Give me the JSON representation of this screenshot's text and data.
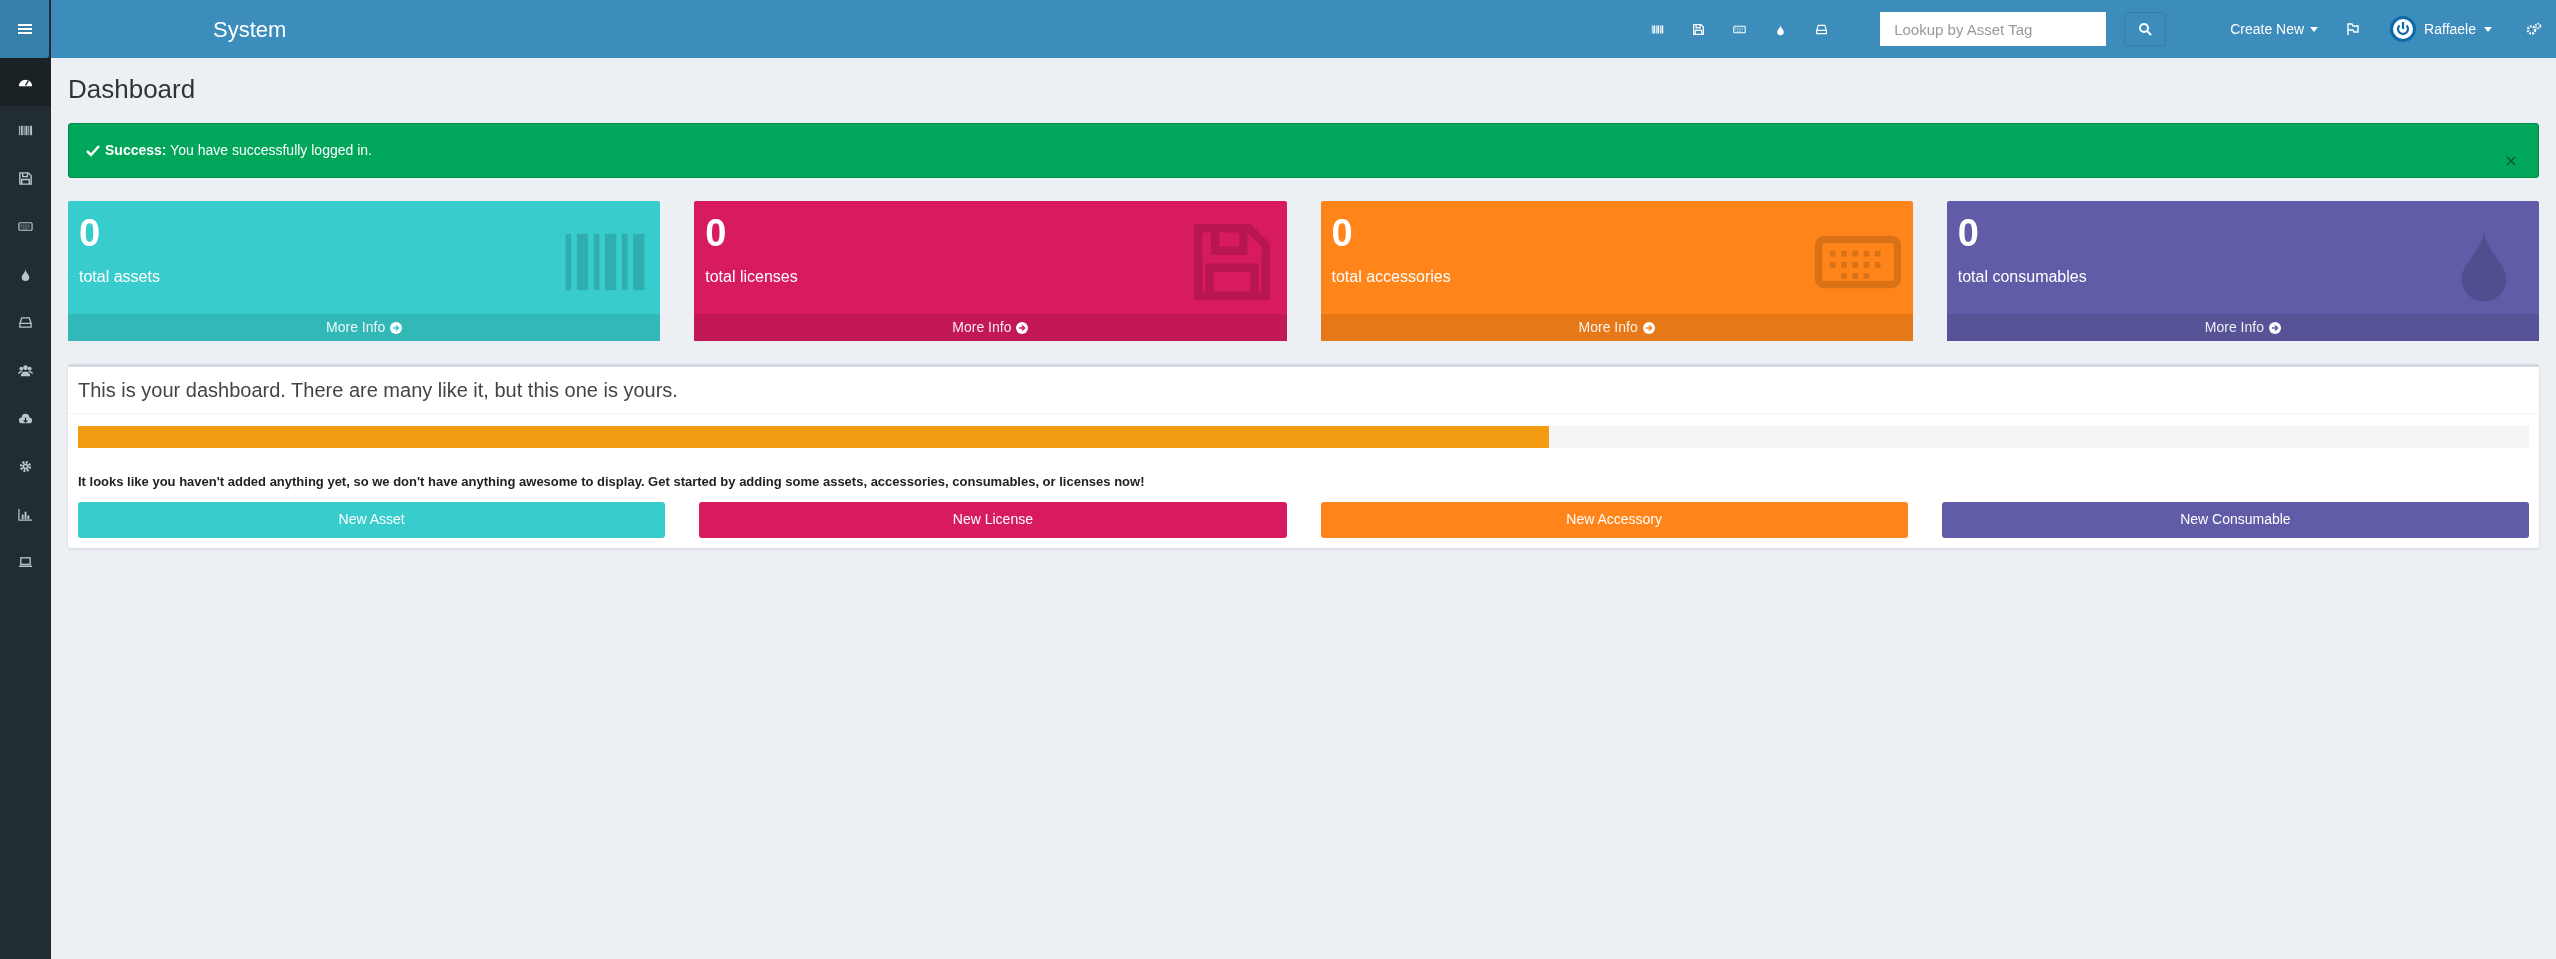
{
  "header": {
    "title": "System",
    "nav_icons": [
      {
        "kind": "barcode"
      },
      {
        "kind": "floppy"
      },
      {
        "kind": "keyboard"
      },
      {
        "kind": "drop"
      },
      {
        "kind": "drive"
      }
    ],
    "search": {
      "placeholder": "Lookup by Asset Tag"
    },
    "create_new": "Create New",
    "user": "Raffaele"
  },
  "sidebar": {
    "items": [
      {
        "kind": "dashboard",
        "selected": true
      },
      {
        "kind": "barcode",
        "selected": false
      },
      {
        "kind": "floppy",
        "selected": false
      },
      {
        "kind": "keyboard",
        "selected": false
      },
      {
        "kind": "drop",
        "selected": false
      },
      {
        "kind": "drive",
        "selected": false
      },
      {
        "kind": "users",
        "selected": false
      },
      {
        "kind": "cloud",
        "selected": false
      },
      {
        "kind": "gear",
        "selected": false
      },
      {
        "kind": "chart",
        "selected": false
      },
      {
        "kind": "laptop",
        "selected": false
      }
    ]
  },
  "page_title": "Dashboard",
  "alert": {
    "text": "**Success:** You have successfully logged in."
  },
  "stats": [
    {
      "count": "0",
      "label": "total assets",
      "link": "More Info",
      "color": "#39cccc",
      "kind": "barcode"
    },
    {
      "count": "0",
      "label": "total licenses",
      "link": "More Info",
      "color": "#d81b60",
      "kind": "floppy"
    },
    {
      "count": "0",
      "label": "total accessories",
      "link": "More Info",
      "color": "#ff851b",
      "kind": "keyboard"
    },
    {
      "count": "0",
      "label": "total consumables",
      "link": "More Info",
      "color": "#605ca8",
      "kind": "drop"
    }
  ],
  "dashboard_box": {
    "heading": "This is your dashboard. There are many like it, but this one is yours.",
    "progress": {
      "level": 0.6
    },
    "message": "It looks like you haven't added anything yet, so we don't have anything awesome to display. Get started by adding some assets, accessories, consumables, or licenses now!",
    "buttons": [
      {
        "label": "New Asset",
        "color": "#39cccc"
      },
      {
        "label": "New License",
        "color": "#d81b60"
      },
      {
        "label": "New Accessory",
        "color": "#ff851b"
      },
      {
        "label": "New Consumable",
        "color": "#605ca8"
      }
    ]
  }
}
